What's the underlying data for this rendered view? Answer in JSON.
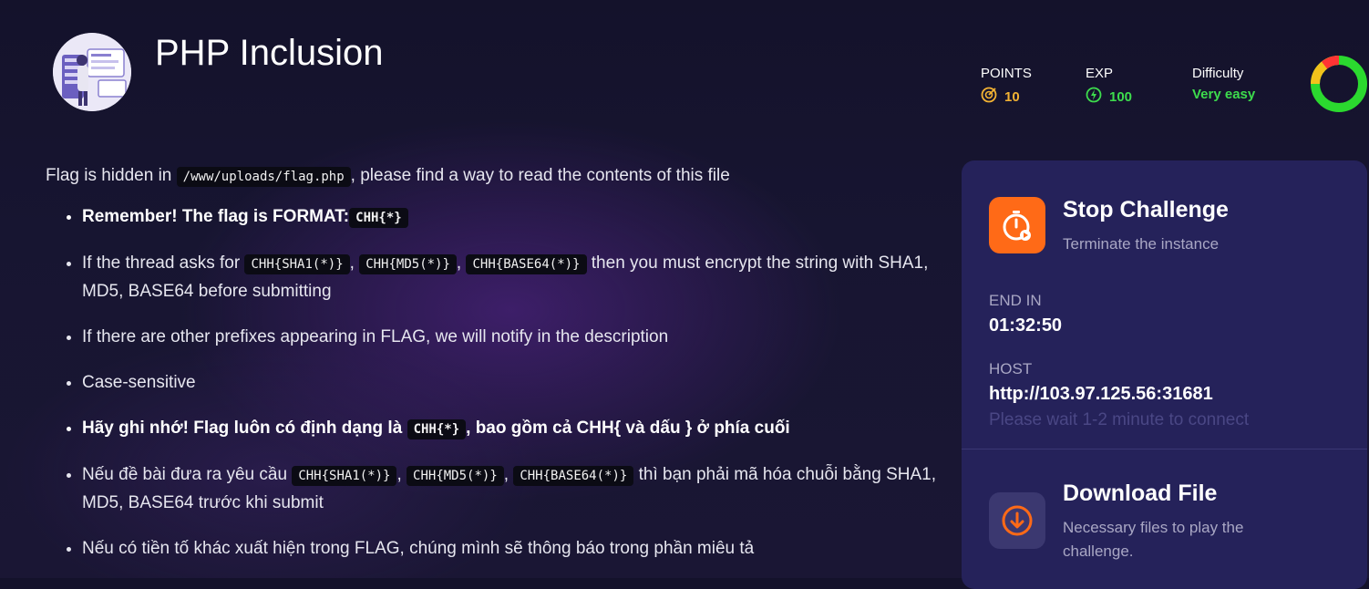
{
  "challenge": {
    "title": "PHP Inclusion",
    "points_label": "POINTS",
    "points_value": "10",
    "exp_label": "EXP",
    "exp_value": "100",
    "difficulty_label": "Difficulty",
    "difficulty_value": "Very easy"
  },
  "colors": {
    "points": "#f2b233",
    "exp": "#3ddc4d",
    "difficulty": "#3ddc4d",
    "stop_button": "#ff6a17",
    "panel": "#25225a"
  },
  "description": {
    "intro_before": "Flag is hidden in ",
    "intro_code": "/www/uploads/flag.php",
    "intro_after": ", please find a way to read the contents of this file",
    "item1_text": "Remember! The flag is FORMAT:",
    "item1_code": "CHH{*}",
    "item2_before": "If the thread asks for ",
    "item2_code1": "CHH{SHA1(*)}",
    "item2_sep1": ", ",
    "item2_code2": "CHH{MD5(*)}",
    "item2_sep2": ", ",
    "item2_code3": "CHH{BASE64(*)}",
    "item2_after": " then you must encrypt the string with SHA1, MD5, BASE64 before submitting",
    "item3": "If there are other prefixes appearing in FLAG, we will notify in the description",
    "item4": "Case-sensitive",
    "item5_before": "Hãy ghi nhớ! Flag luôn có định dạng là ",
    "item5_code": "CHH{*}",
    "item5_after": ", bao gồm cả CHH{ và dấu } ở phía cuối",
    "item6_before": "Nếu đề bài đưa ra yêu cầu ",
    "item6_code1": "CHH{SHA1(*)}",
    "item6_sep1": ", ",
    "item6_code2": "CHH{MD5(*)}",
    "item6_sep2": ", ",
    "item6_code3": "CHH{BASE64(*)}",
    "item6_after": " thì bạn phải mã hóa chuỗi bằng SHA1, MD5, BASE64 trước khi submit",
    "item7": "Nếu có tiền tố khác xuất hiện trong FLAG, chúng mình sẽ thông báo trong phần miêu tả"
  },
  "panel": {
    "stop_title": "Stop Challenge",
    "stop_sub": "Terminate the instance",
    "end_label": "END IN",
    "end_value": "01:32:50",
    "host_label": "HOST",
    "host_value": "http://103.97.125.56:31681",
    "wait_note": "Please wait 1-2 minute to connect",
    "download_title": "Download File",
    "download_sub": "Necessary files to play the challenge."
  },
  "icons": {
    "logo": "server-illustration-icon",
    "points": "target-icon",
    "exp": "bolt-icon",
    "stop": "stopwatch-icon",
    "download": "download-icon"
  }
}
